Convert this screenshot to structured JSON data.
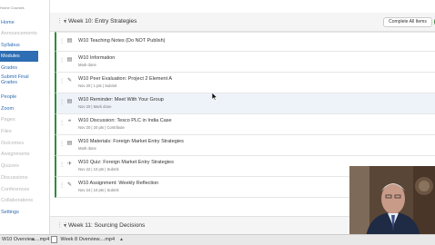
{
  "sidebar": {
    "header": "Home Courses",
    "items": [
      {
        "label": "Home",
        "state": "link"
      },
      {
        "label": "Announcements",
        "state": "grey"
      },
      {
        "label": "Syllabus",
        "state": "link"
      },
      {
        "label": "Modules",
        "state": "active"
      },
      {
        "label": "Grades",
        "state": "link"
      },
      {
        "label": "Submit Final Grades",
        "state": "link"
      },
      {
        "label": "People",
        "state": "link"
      },
      {
        "label": "Zoom",
        "state": "link"
      },
      {
        "label": "Pages",
        "state": "grey"
      },
      {
        "label": "Files",
        "state": "grey"
      },
      {
        "label": "Outcomes",
        "state": "grey"
      },
      {
        "label": "Assignments",
        "state": "grey"
      },
      {
        "label": "Quizzes",
        "state": "grey"
      },
      {
        "label": "Discussions",
        "state": "grey"
      },
      {
        "label": "Conferences",
        "state": "grey"
      },
      {
        "label": "Collaborations",
        "state": "grey"
      },
      {
        "label": "Settings",
        "state": "link"
      }
    ]
  },
  "module": {
    "title": "Week 10: Entry Strategies",
    "complete_button": "Complete All Items",
    "items": [
      {
        "title": "W10 Teaching Notes (Do NOT Publish)",
        "meta": "",
        "icon": "page-icon"
      },
      {
        "title": "W10 Information",
        "meta": "Mark done",
        "icon": "page-icon"
      },
      {
        "title": "W10 Peer Evaluation: Project 2 Element A",
        "meta": "Nov 20 | 1 pts | Submit",
        "icon": "assignment-icon"
      },
      {
        "title": "W10 Reminder: Meet With Your Group",
        "meta": "Nov 20 | Mark done",
        "icon": "page-icon"
      },
      {
        "title": "W10 Discussion: Tesco PLC in India Case",
        "meta": "Nov 20 | 20 pts | Contribute",
        "icon": "discussion-icon"
      },
      {
        "title": "W10 Materials: Foreign Market Entry Strategies",
        "meta": "Mark done",
        "icon": "page-icon"
      },
      {
        "title": "W10 Quiz: Foreign Market Entry Strategies",
        "meta": "Nov 22 | 10 pts | Submit",
        "icon": "quiz-icon"
      },
      {
        "title": "W10 Assignment: Weekly Reflection",
        "meta": "Nov 24 | 10 pts | Submit",
        "icon": "assignment-icon"
      }
    ]
  },
  "next_module": {
    "title": "Week 11: Sourcing Decisions"
  },
  "downloads": [
    {
      "name": "W10 Overview....mp4"
    },
    {
      "name": "Week 8 Overview....mp4"
    }
  ],
  "colors": {
    "accent": "#2d6db3",
    "published": "#2e8b3d"
  }
}
